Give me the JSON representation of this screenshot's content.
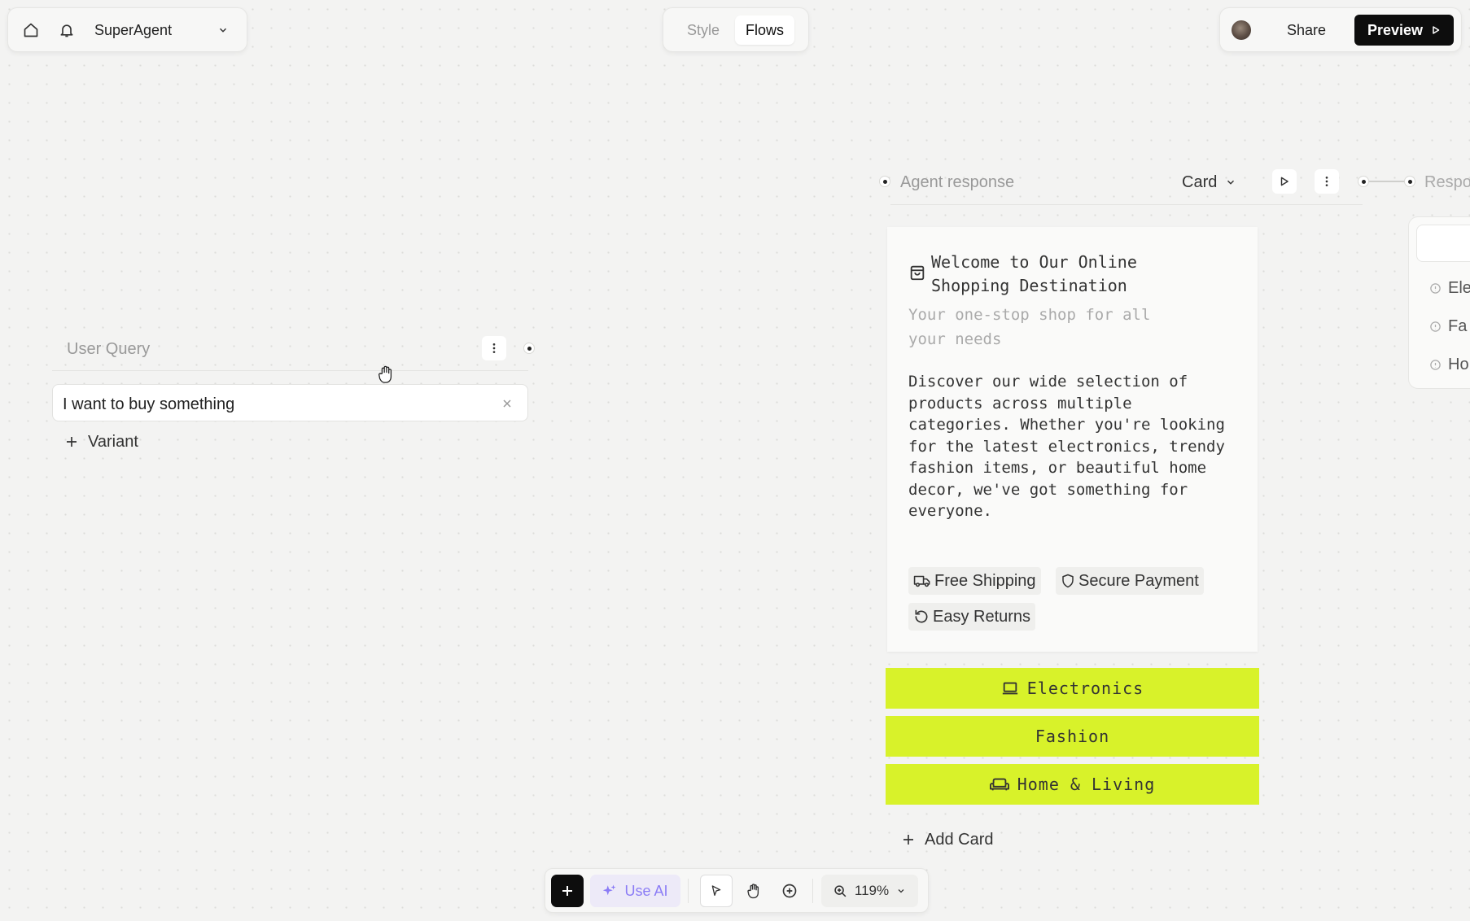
{
  "topbar": {
    "project_name": "SuperAgent",
    "tabs": [
      {
        "label": "Style",
        "active": false
      },
      {
        "label": "Flows",
        "active": true
      }
    ],
    "share_label": "Share",
    "preview_label": "Preview"
  },
  "user_query": {
    "title": "User Query",
    "input_value": "I want to buy something",
    "add_variant_label": "Variant"
  },
  "agent_response": {
    "title": "Agent response",
    "type_value": "Card",
    "next_node_title_partial": "Respo",
    "card": {
      "title": "Welcome to Our Online Shopping Destination",
      "subtitle": "Your one-stop shop for all your needs",
      "body": "Discover our wide selection of products across multiple categories. Whether you're looking for the latest electronics, trendy fashion items, or beautiful home decor, we've got something for everyone.",
      "tags": [
        {
          "label": "Free Shipping",
          "icon": "truck-icon"
        },
        {
          "label": "Secure Payment",
          "icon": "shield-icon"
        },
        {
          "label": "Easy Returns",
          "icon": "rotate-ccw-icon"
        }
      ]
    },
    "buttons": [
      {
        "label": "Electronics",
        "icon": "laptop-icon"
      },
      {
        "label": "Fashion",
        "icon": ""
      },
      {
        "label": "Home & Living",
        "icon": "sofa-icon"
      }
    ],
    "add_card_label": "Add Card",
    "next_list_items_partial": [
      "Ele",
      "Fa",
      "Ho"
    ]
  },
  "toolbar": {
    "use_ai_label": "Use AI",
    "zoom": "119%"
  },
  "colors": {
    "accent_lime": "#d8f22a",
    "use_ai_purple": "#8b7cf6",
    "canvas_bg": "#f3f3f2"
  }
}
